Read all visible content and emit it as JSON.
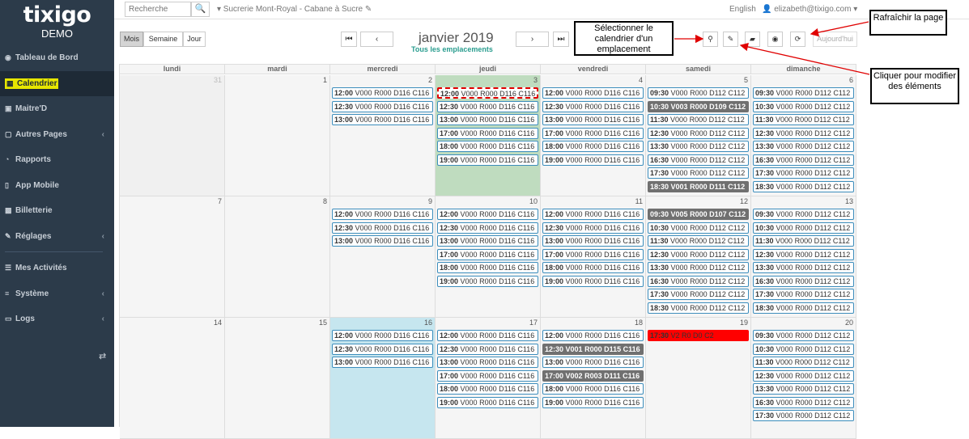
{
  "sidebar": {
    "logo": "tixigo",
    "env": "DEMO",
    "items": [
      {
        "label": "Tableau de Bord",
        "icon": "dashboard-icon",
        "glyph": "◉",
        "chevron": false,
        "active": false
      },
      {
        "label": "Calendrier",
        "icon": "calendar-icon",
        "glyph": "▦",
        "chevron": false,
        "active": true
      },
      {
        "label": "Maitre'D",
        "icon": "book-icon",
        "glyph": "▣",
        "chevron": false,
        "active": false
      },
      {
        "label": "Autres Pages",
        "icon": "file-icon",
        "glyph": "▢",
        "chevron": true,
        "active": false
      },
      {
        "label": "Rapports",
        "icon": "chart-icon",
        "glyph": "◔",
        "chevron": false,
        "active": false
      },
      {
        "label": "App Mobile",
        "icon": "mobile-icon",
        "glyph": "▯",
        "chevron": false,
        "active": false
      },
      {
        "label": "Billetterie",
        "icon": "ticket-icon",
        "glyph": "▩",
        "chevron": false,
        "active": false
      },
      {
        "label": "Réglages",
        "icon": "wrench-icon",
        "glyph": "✎",
        "chevron": true,
        "active": false
      },
      {
        "label": "Mes Activités",
        "icon": "list-icon",
        "glyph": "☰",
        "chevron": false,
        "active": false,
        "separator_before": true
      },
      {
        "label": "Système",
        "icon": "database-icon",
        "glyph": "≡",
        "chevron": true,
        "active": false
      },
      {
        "label": "Logs",
        "icon": "folder-icon",
        "glyph": "▭",
        "chevron": true,
        "active": false
      }
    ],
    "toggle_glyph": "⇄"
  },
  "topbar": {
    "search_placeholder": "Recherche",
    "search_icon": "🔍",
    "location": "▾ Sucrerie Mont-Royal - Cabane à Sucre ✎",
    "language": "English",
    "user": "👤 elizabeth@tixigo.com ▾"
  },
  "toolbar": {
    "views": [
      {
        "label": "Mois",
        "active": true
      },
      {
        "label": "Semaine",
        "active": false
      },
      {
        "label": "Jour",
        "active": false
      }
    ],
    "first_glyph": "⏮",
    "prev_glyph": "‹",
    "next_glyph": "›",
    "last_glyph": "⏭",
    "title": "janvier 2019",
    "subtitle": "Tous les emplacements",
    "icon_buttons": [
      {
        "name": "location-pin-icon",
        "glyph": "⚲"
      },
      {
        "name": "pencil-icon",
        "glyph": "✎"
      },
      {
        "name": "folder-open-icon",
        "glyph": "▰"
      },
      {
        "name": "eye-icon",
        "glyph": "◉"
      },
      {
        "name": "refresh-icon",
        "glyph": "⟳"
      }
    ],
    "today": "Aujourd'hui"
  },
  "callouts": {
    "select_location": "Sélectionner le calendrier d'un emplacement",
    "refresh": "Rafraîchir la page",
    "edit": "Cliquer pour modifier des éléments"
  },
  "calendar": {
    "weekdays": [
      "lundi",
      "mardi",
      "mercredi",
      "jeudi",
      "vendredi",
      "samedi",
      "dimanche"
    ],
    "weeks": [
      {
        "days": [
          {
            "num": "31",
            "other": true,
            "events": []
          },
          {
            "num": "1",
            "events": []
          },
          {
            "num": "2",
            "events": [
              {
                "time": "12:00",
                "text": "V000 R000 D116 C116"
              },
              {
                "time": "12:30",
                "text": "V000 R000 D116 C116"
              },
              {
                "time": "13:00",
                "text": "V000 R000 D116 C116"
              }
            ]
          },
          {
            "num": "3",
            "today": true,
            "events": [
              {
                "time": "12:00",
                "text": "V000 R000 D116 C116",
                "style": "dashed"
              },
              {
                "time": "12:30",
                "text": "V000 R000 D116 C116"
              },
              {
                "time": "13:00",
                "text": "V000 R000 D116 C116"
              },
              {
                "time": "17:00",
                "text": "V000 R000 D116 C116"
              },
              {
                "time": "18:00",
                "text": "V000 R000 D116 C116"
              },
              {
                "time": "19:00",
                "text": "V000 R000 D116 C116"
              }
            ]
          },
          {
            "num": "4",
            "events": [
              {
                "time": "12:00",
                "text": "V000 R000 D116 C116"
              },
              {
                "time": "12:30",
                "text": "V000 R000 D116 C116"
              },
              {
                "time": "13:00",
                "text": "V000 R000 D116 C116"
              },
              {
                "time": "17:00",
                "text": "V000 R000 D116 C116"
              },
              {
                "time": "18:00",
                "text": "V000 R000 D116 C116"
              },
              {
                "time": "19:00",
                "text": "V000 R000 D116 C116"
              }
            ]
          },
          {
            "num": "5",
            "events": [
              {
                "time": "09:30",
                "text": "V000 R000 D112 C112"
              },
              {
                "time": "10:30",
                "text": "V003 R000 D109 C112",
                "style": "dark"
              },
              {
                "time": "11:30",
                "text": "V000 R000 D112 C112"
              },
              {
                "time": "12:30",
                "text": "V000 R000 D112 C112"
              },
              {
                "time": "13:30",
                "text": "V000 R000 D112 C112"
              },
              {
                "time": "16:30",
                "text": "V000 R000 D112 C112"
              },
              {
                "time": "17:30",
                "text": "V000 R000 D112 C112"
              },
              {
                "time": "18:30",
                "text": "V001 R000 D111 C112",
                "style": "dark"
              }
            ]
          },
          {
            "num": "6",
            "events": [
              {
                "time": "09:30",
                "text": "V000 R000 D112 C112"
              },
              {
                "time": "10:30",
                "text": "V000 R000 D112 C112"
              },
              {
                "time": "11:30",
                "text": "V000 R000 D112 C112"
              },
              {
                "time": "12:30",
                "text": "V000 R000 D112 C112"
              },
              {
                "time": "13:30",
                "text": "V000 R000 D112 C112"
              },
              {
                "time": "16:30",
                "text": "V000 R000 D112 C112"
              },
              {
                "time": "17:30",
                "text": "V000 R000 D112 C112"
              },
              {
                "time": "18:30",
                "text": "V000 R000 D112 C112"
              }
            ]
          }
        ]
      },
      {
        "days": [
          {
            "num": "7",
            "events": []
          },
          {
            "num": "8",
            "events": []
          },
          {
            "num": "9",
            "events": [
              {
                "time": "12:00",
                "text": "V000 R000 D116 C116"
              },
              {
                "time": "12:30",
                "text": "V000 R000 D116 C116"
              },
              {
                "time": "13:00",
                "text": "V000 R000 D116 C116"
              }
            ]
          },
          {
            "num": "10",
            "events": [
              {
                "time": "12:00",
                "text": "V000 R000 D116 C116"
              },
              {
                "time": "12:30",
                "text": "V000 R000 D116 C116"
              },
              {
                "time": "13:00",
                "text": "V000 R000 D116 C116"
              },
              {
                "time": "17:00",
                "text": "V000 R000 D116 C116"
              },
              {
                "time": "18:00",
                "text": "V000 R000 D116 C116"
              },
              {
                "time": "19:00",
                "text": "V000 R000 D116 C116"
              }
            ]
          },
          {
            "num": "11",
            "events": [
              {
                "time": "12:00",
                "text": "V000 R000 D116 C116"
              },
              {
                "time": "12:30",
                "text": "V000 R000 D116 C116"
              },
              {
                "time": "13:00",
                "text": "V000 R000 D116 C116"
              },
              {
                "time": "17:00",
                "text": "V000 R000 D116 C116"
              },
              {
                "time": "18:00",
                "text": "V000 R000 D116 C116"
              },
              {
                "time": "19:00",
                "text": "V000 R000 D116 C116"
              }
            ]
          },
          {
            "num": "12",
            "events": [
              {
                "time": "09:30",
                "text": "V005 R000 D107 C112",
                "style": "dark"
              },
              {
                "time": "10:30",
                "text": "V000 R000 D112 C112"
              },
              {
                "time": "11:30",
                "text": "V000 R000 D112 C112"
              },
              {
                "time": "12:30",
                "text": "V000 R000 D112 C112"
              },
              {
                "time": "13:30",
                "text": "V000 R000 D112 C112"
              },
              {
                "time": "16:30",
                "text": "V000 R000 D112 C112"
              },
              {
                "time": "17:30",
                "text": "V000 R000 D112 C112"
              },
              {
                "time": "18:30",
                "text": "V000 R000 D112 C112"
              }
            ]
          },
          {
            "num": "13",
            "events": [
              {
                "time": "09:30",
                "text": "V000 R000 D112 C112"
              },
              {
                "time": "10:30",
                "text": "V000 R000 D112 C112"
              },
              {
                "time": "11:30",
                "text": "V000 R000 D112 C112"
              },
              {
                "time": "12:30",
                "text": "V000 R000 D112 C112"
              },
              {
                "time": "13:30",
                "text": "V000 R000 D112 C112"
              },
              {
                "time": "16:30",
                "text": "V000 R000 D112 C112"
              },
              {
                "time": "17:30",
                "text": "V000 R000 D112 C112"
              },
              {
                "time": "18:30",
                "text": "V000 R000 D112 C112"
              }
            ]
          }
        ]
      },
      {
        "days": [
          {
            "num": "14",
            "events": []
          },
          {
            "num": "15",
            "events": []
          },
          {
            "num": "16",
            "highlight": true,
            "events": [
              {
                "time": "12:00",
                "text": "V000 R000 D116 C116"
              },
              {
                "time": "12:30",
                "text": "V000 R000 D116 C116"
              },
              {
                "time": "13:00",
                "text": "V000 R000 D116 C116"
              }
            ]
          },
          {
            "num": "17",
            "events": [
              {
                "time": "12:00",
                "text": "V000 R000 D116 C116"
              },
              {
                "time": "12:30",
                "text": "V000 R000 D116 C116"
              },
              {
                "time": "13:00",
                "text": "V000 R000 D116 C116"
              },
              {
                "time": "17:00",
                "text": "V000 R000 D116 C116"
              },
              {
                "time": "18:00",
                "text": "V000 R000 D116 C116"
              },
              {
                "time": "19:00",
                "text": "V000 R000 D116 C116"
              }
            ]
          },
          {
            "num": "18",
            "events": [
              {
                "time": "12:00",
                "text": "V000 R000 D116 C116"
              },
              {
                "time": "12:30",
                "text": "V001 R000 D115 C116",
                "style": "dark"
              },
              {
                "time": "13:00",
                "text": "V000 R000 D116 C116"
              },
              {
                "time": "17:00",
                "text": "V002 R003 D111 C116",
                "style": "dark"
              },
              {
                "time": "18:00",
                "text": "V000 R000 D116 C116"
              },
              {
                "time": "19:00",
                "text": "V000 R000 D116 C116"
              }
            ]
          },
          {
            "num": "19",
            "events": [
              {
                "time": "17:30",
                "text": "V2 R0 D0 C2",
                "style": "red"
              }
            ]
          },
          {
            "num": "20",
            "events": [
              {
                "time": "09:30",
                "text": "V000 R000 D112 C112"
              },
              {
                "time": "10:30",
                "text": "V000 R000 D112 C112"
              },
              {
                "time": "11:30",
                "text": "V000 R000 D112 C112"
              },
              {
                "time": "12:30",
                "text": "V000 R000 D112 C112"
              },
              {
                "time": "13:30",
                "text": "V000 R000 D112 C112"
              },
              {
                "time": "16:30",
                "text": "V000 R000 D112 C112"
              },
              {
                "time": "17:30",
                "text": "V000 R000 D112 C112"
              }
            ]
          }
        ]
      }
    ]
  },
  "colors": {
    "sidebar": "#2c3b4a",
    "today": "#bfdcbf",
    "highlight": "#c6e6ef",
    "event_border": "#3c8dbc",
    "event_dark": "#707070",
    "event_red": "#ff0000",
    "annotation": "#e00000"
  }
}
